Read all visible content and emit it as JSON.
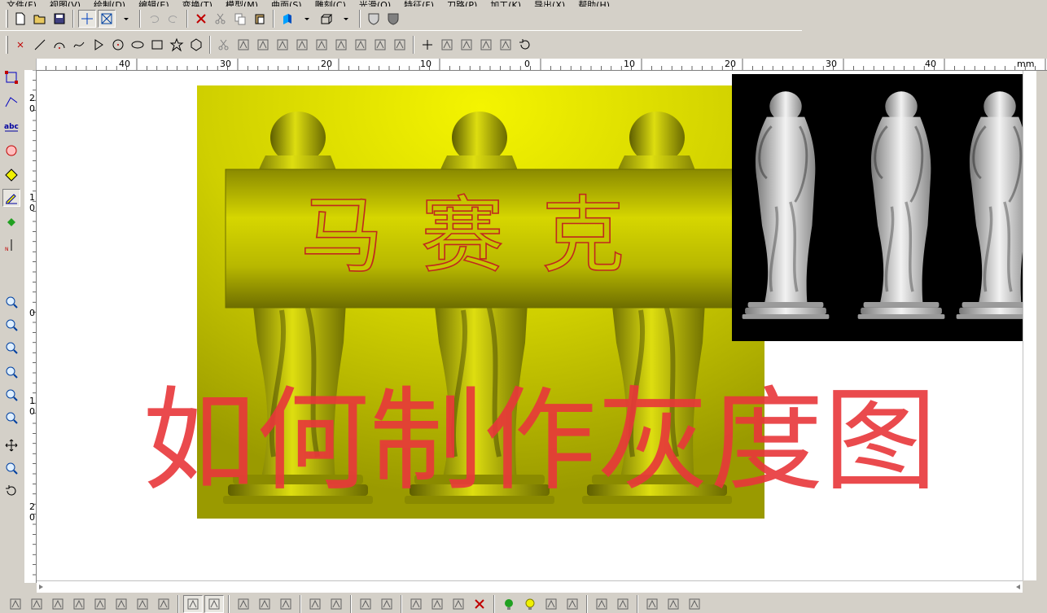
{
  "menu": [
    "文件(F)",
    "视图(V)",
    "绘制(D)",
    "编辑(E)",
    "变换(T)",
    "模型(M)",
    "曲面(S)",
    "雕刻(C)",
    "光滑(O)",
    "特征(F)",
    "刀路(P)",
    "加工(K)",
    "导出(X)",
    "帮助(H)"
  ],
  "ruler_top": {
    "unit": "mm",
    "labels": [
      "40",
      "30",
      "20",
      "10",
      "0",
      "10",
      "20",
      "30",
      "40"
    ]
  },
  "ruler_left": {
    "labels": [
      "2\n0",
      "1\n0",
      "0",
      "1\n0",
      "2\n0"
    ]
  },
  "canvas": {
    "relief_title": "马赛克",
    "overlay_caption": "如何制作灰度图",
    "colors": {
      "relief_light": "#f2f200",
      "relief_mid": "#c8c800",
      "relief_dark": "#6c6c00",
      "caption": "#e8363a",
      "title_outline": "#c0281e",
      "grayscale_bg": "#000000"
    }
  },
  "icons": {
    "toolbar_top": [
      "new-file-icon",
      "open-folder-icon",
      "save-icon",
      "crosshair-icon",
      "view-box-icon",
      "dropdown-icon",
      "undo-icon",
      "redo-icon",
      "delete-icon",
      "cut-icon",
      "copy-icon",
      "paste-icon",
      "color-cube-icon",
      "dropdown-icon",
      "box-view-icon",
      "dropdown-icon",
      "shield-light-icon",
      "shield-dark-icon"
    ],
    "toolbar_draw": [
      "point-icon",
      "line-icon",
      "arc-icon",
      "curve-icon",
      "triangle-icon",
      "circle-icon",
      "ellipse-icon",
      "rectangle-icon",
      "star-icon",
      "polygon-icon",
      "scissors-icon",
      "trim-icon",
      "corner-icon",
      "fillet-icon",
      "chamfer-icon",
      "extend-icon",
      "offset-icon",
      "array-icon",
      "align-icon",
      "mirror-icon",
      "plus-icon",
      "dimension-icon",
      "angle-dim-icon",
      "grid-snap-icon",
      "angle-icon",
      "rotate-icon"
    ],
    "left": [
      "select-box-icon",
      "node-edit-icon",
      "text-abc-icon",
      "circle-select-icon",
      "diamond-icon",
      "pencil-icon",
      "paint-bucket-icon",
      "measure-icon",
      "zoom-window-icon",
      "zoom-out-icon",
      "zoom-in-icon",
      "zoom-prev-icon",
      "view-eye-icon",
      "zoom-all-icon",
      "pan-icon",
      "zoom-icon",
      "rotate-view-icon"
    ],
    "bottom": [
      "snap-line-icon",
      "snap-cross-icon",
      "snap-corner-icon",
      "snap-x-icon",
      "snap-arc-icon",
      "snap-circle-icon",
      "snap-perp-icon",
      "snap-tangent-icon",
      "snap-grid-icon",
      "snap-axes-icon",
      "layer-1-icon",
      "layer-2-icon",
      "layer-3-icon",
      "align-left-icon",
      "align-right-icon",
      "pointer-add-icon",
      "pointer-remove-icon",
      "node-add-icon",
      "node-move-icon",
      "node-x-icon",
      "delete-red-icon",
      "bulb-on-icon",
      "bulb-yellow-icon",
      "tool-gear-icon",
      "palette-icon",
      "arrow-left-icon",
      "arrow-right-icon",
      "book-icon",
      "grid-table-icon",
      "brush-icon"
    ]
  }
}
